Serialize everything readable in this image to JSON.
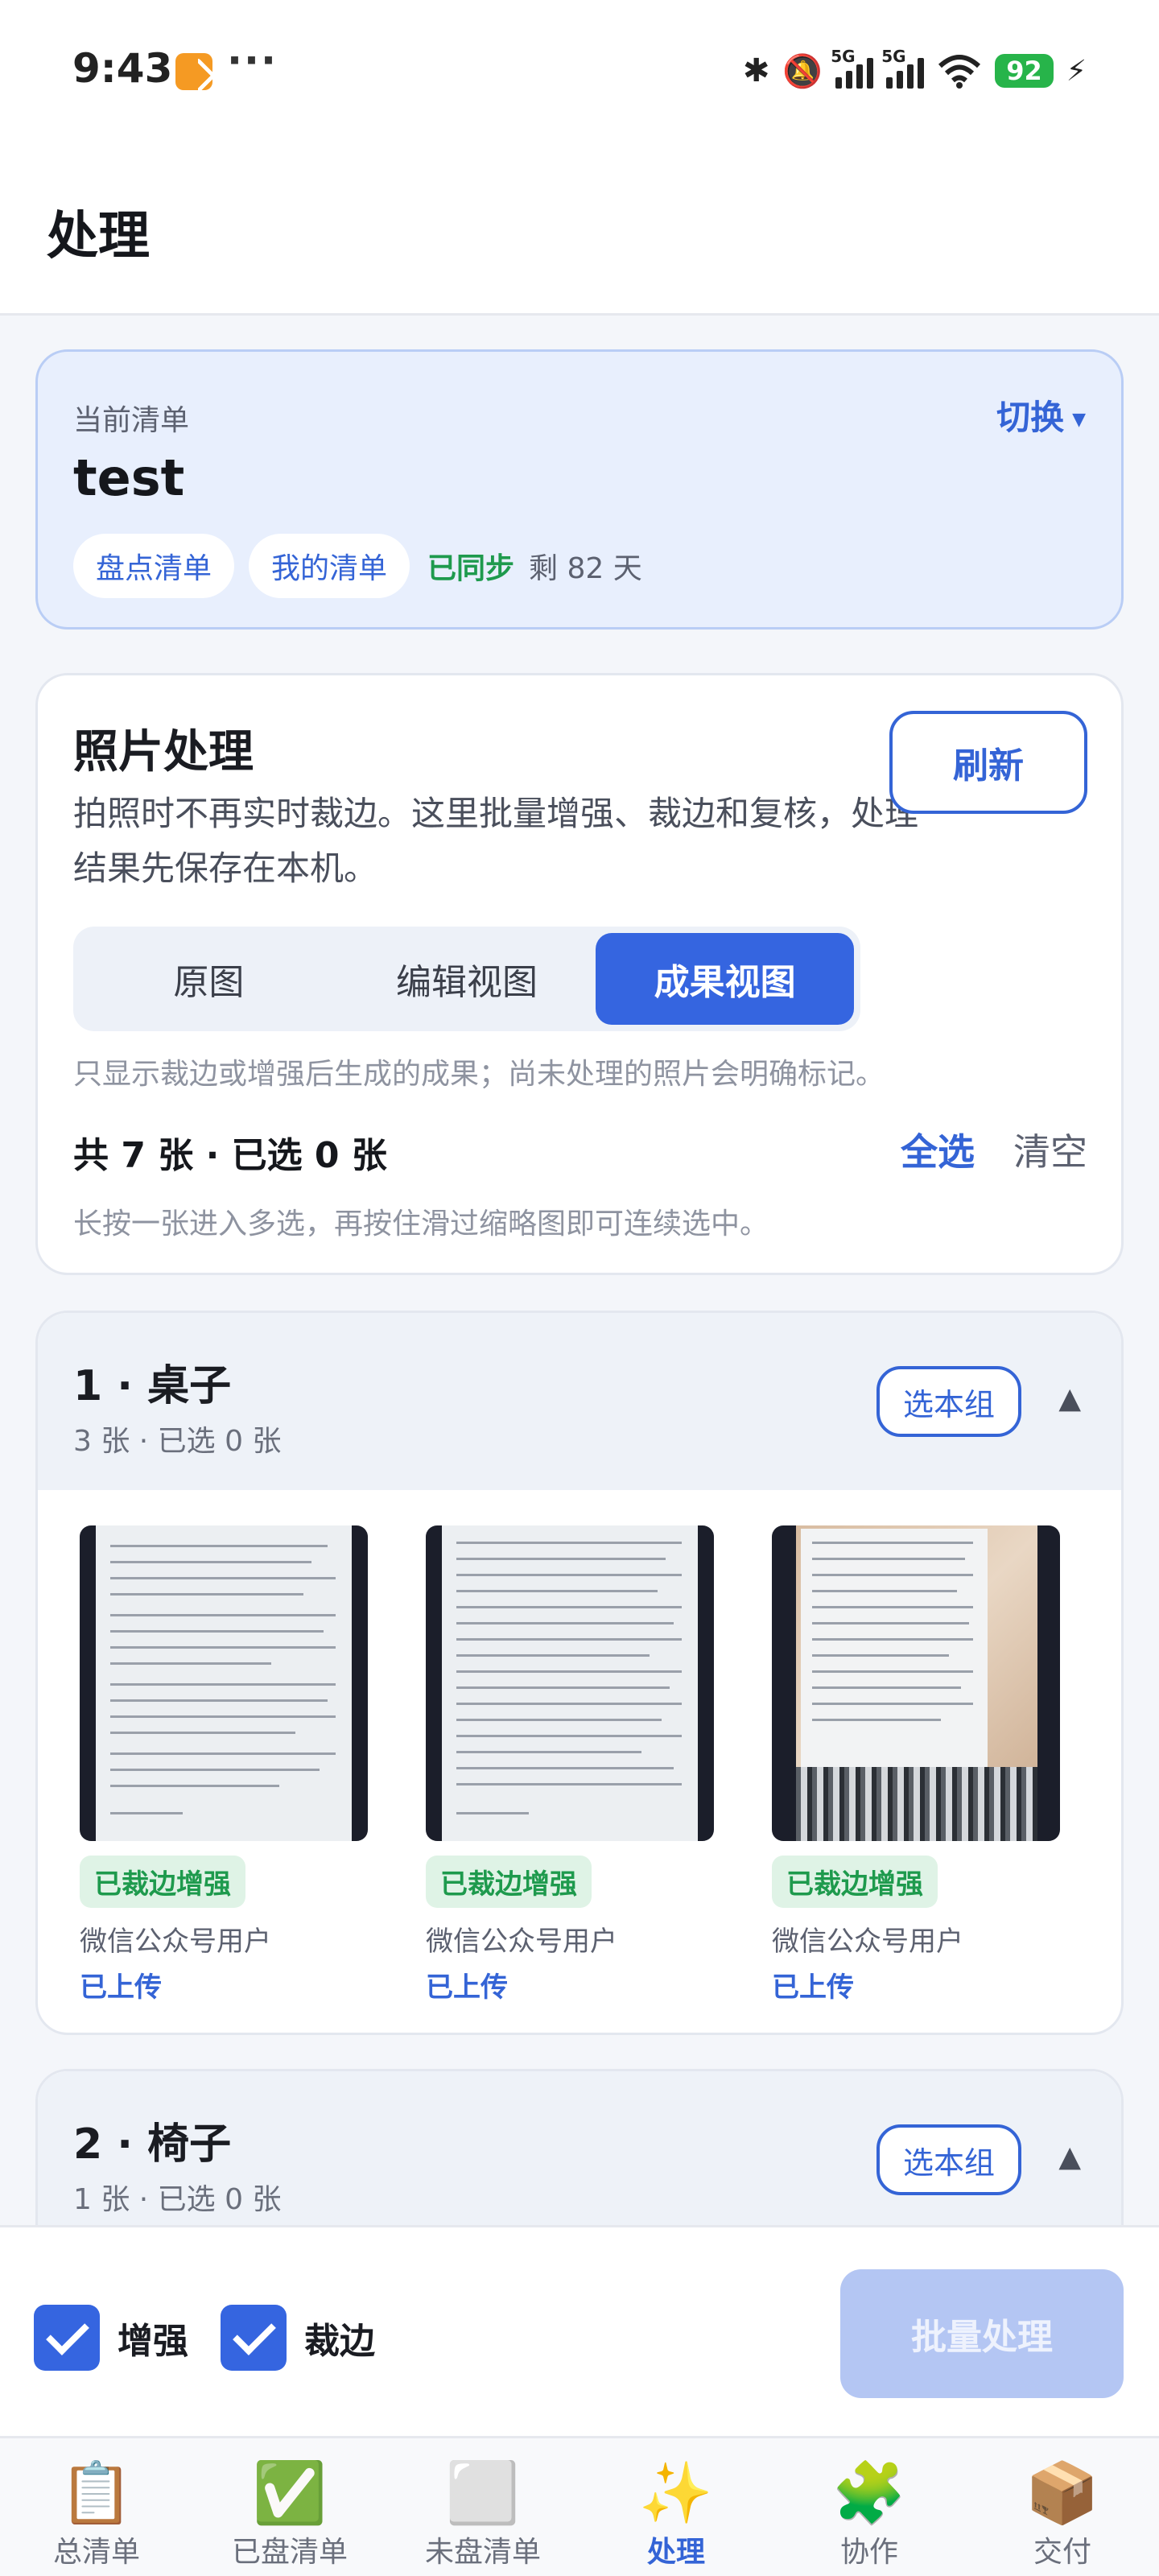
{
  "status_bar": {
    "time": "9:43",
    "more": "···",
    "net1": "5G",
    "net2": "5G",
    "battery": "92"
  },
  "header": {
    "title": "处理"
  },
  "current_list": {
    "label": "当前清单",
    "switch_label": "切换",
    "name": "test",
    "tags": [
      "盘点清单",
      "我的清单"
    ],
    "sync_status": "已同步",
    "remaining": "剩 82 天"
  },
  "photo_processing": {
    "title": "照片处理",
    "description": "拍照时不再实时裁边。这里批量增强、裁边和复核，处理结果先保存在本机。",
    "refresh_label": "刷新",
    "view_tabs": [
      "原图",
      "编辑视图",
      "成果视图"
    ],
    "active_view": "成果视图",
    "hint": "只显示裁边或增强后生成的成果；尚未处理的照片会明确标记。",
    "count_text": "共 7 张 · 已选 0 张",
    "select_all": "全选",
    "clear": "清空",
    "hint2": "长按一张进入多选，再按住滑过缩略图即可连续选中。"
  },
  "groups": [
    {
      "title": "1 · 桌子",
      "subtitle": "3 张 · 已选 0 张",
      "select_label": "选本组",
      "expanded": true,
      "photos": [
        {
          "badge": "已裁边增强",
          "user": "微信公众号用户",
          "status": "已上传"
        },
        {
          "badge": "已裁边增强",
          "user": "微信公众号用户",
          "status": "已上传"
        },
        {
          "badge": "已裁边增强",
          "user": "微信公众号用户",
          "status": "已上传"
        }
      ]
    },
    {
      "title": "2 · 椅子",
      "subtitle": "1 张 · 已选 0 张",
      "select_label": "选本组",
      "expanded": true
    }
  ],
  "actions": {
    "enhance_label": "增强",
    "enhance_checked": true,
    "crop_label": "裁边",
    "crop_checked": true,
    "batch_label": "批量处理",
    "batch_enabled": false
  },
  "tabs": [
    {
      "label": "总清单",
      "icon": "clipboard-icon"
    },
    {
      "label": "已盘清单",
      "icon": "check-mark-icon"
    },
    {
      "label": "未盘清单",
      "icon": "empty-square-icon"
    },
    {
      "label": "处理",
      "icon": "sparkles-icon",
      "active": true
    },
    {
      "label": "协作",
      "icon": "puzzle-icon"
    },
    {
      "label": "交付",
      "icon": "package-icon"
    }
  ],
  "colors": {
    "accent": "#3565e0",
    "success": "#1e9a4d",
    "disabled_button": "#b4c6f3"
  }
}
